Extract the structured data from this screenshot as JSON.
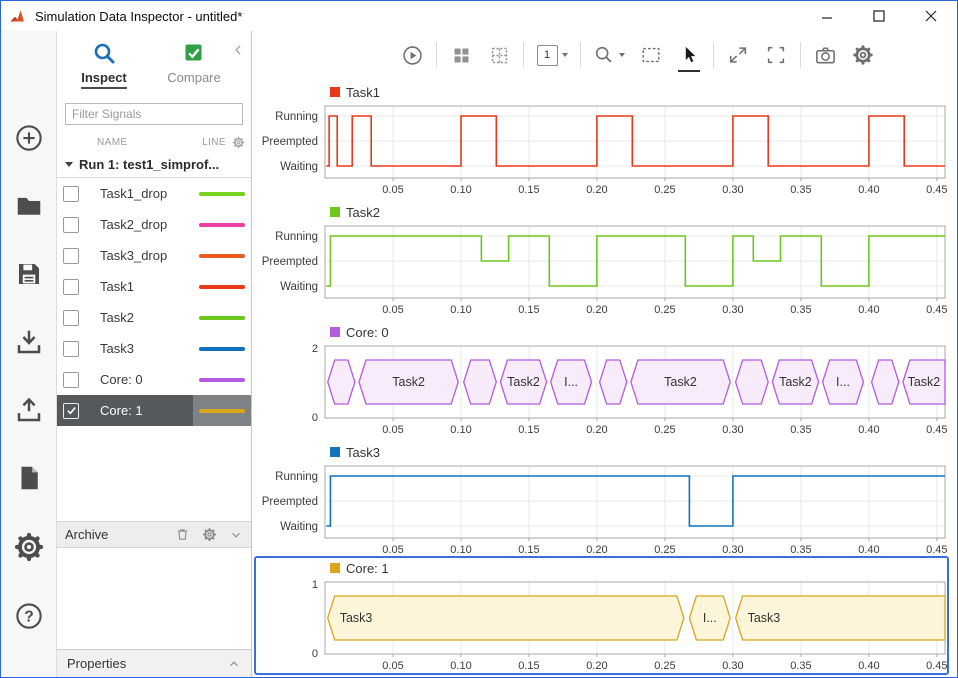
{
  "window": {
    "title": "Simulation Data Inspector - untitled*"
  },
  "rail": {
    "icons": [
      "add",
      "open",
      "save",
      "import",
      "export",
      "new-document",
      "settings",
      "help"
    ]
  },
  "panel": {
    "tabs": [
      {
        "label": "Inspect",
        "active": true
      },
      {
        "label": "Compare",
        "active": false
      }
    ],
    "filter": {
      "placeholder": "Filter Signals"
    },
    "columns": {
      "name": "NAME",
      "line": "LINE"
    },
    "run": {
      "label": "Run 1: test1_simprof..."
    },
    "signals": [
      {
        "name": "Task1_drop",
        "color": "#76d21e",
        "checked": false,
        "selected": false
      },
      {
        "name": "Task2_drop",
        "color": "#ea3fa4",
        "checked": false,
        "selected": false
      },
      {
        "name": "Task3_drop",
        "color": "#ea5a1e",
        "checked": false,
        "selected": false
      },
      {
        "name": "Task1",
        "color": "#e8391b",
        "checked": false,
        "selected": false
      },
      {
        "name": "Task2",
        "color": "#6ec71d",
        "checked": false,
        "selected": false
      },
      {
        "name": "Task3",
        "color": "#1272bd",
        "checked": false,
        "selected": false
      },
      {
        "name": "Core: 0",
        "color": "#b45be0",
        "checked": false,
        "selected": false
      },
      {
        "name": "Core: 1",
        "color": "#d9a61c",
        "checked": true,
        "selected": true
      }
    ],
    "archive": {
      "label": "Archive"
    },
    "properties": {
      "label": "Properties"
    }
  },
  "toolbar": {
    "layout_value": "1"
  },
  "axis": {
    "xmin": 0,
    "xmax": 0.456,
    "xticks": [
      0.05,
      0.1,
      0.15,
      0.2,
      0.25,
      0.3,
      0.35,
      0.4,
      0.45
    ]
  },
  "chart_data": [
    {
      "type": "step",
      "title": "Task1",
      "color": "#e8391b",
      "ylabels": [
        "Waiting",
        "Preempted",
        "Running"
      ],
      "steps": [
        [
          0.001,
          0
        ],
        [
          0.003,
          2
        ],
        [
          0.009,
          0
        ],
        [
          0.02,
          2
        ],
        [
          0.034,
          0
        ],
        [
          0.1,
          2
        ],
        [
          0.126,
          0
        ],
        [
          0.2,
          2
        ],
        [
          0.226,
          0
        ],
        [
          0.3,
          2
        ],
        [
          0.326,
          0
        ],
        [
          0.4,
          2
        ],
        [
          0.426,
          0
        ]
      ]
    },
    {
      "type": "step",
      "title": "Task2",
      "color": "#6ec71d",
      "ylabels": [
        "Waiting",
        "Preempted",
        "Running"
      ],
      "steps": [
        [
          0.001,
          0
        ],
        [
          0.004,
          2
        ],
        [
          0.115,
          1
        ],
        [
          0.135,
          2
        ],
        [
          0.165,
          0
        ],
        [
          0.2,
          2
        ],
        [
          0.265,
          0
        ],
        [
          0.3,
          2
        ],
        [
          0.315,
          1
        ],
        [
          0.335,
          2
        ],
        [
          0.365,
          0
        ],
        [
          0.4,
          2
        ]
      ]
    },
    {
      "type": "schedule",
      "title": "Core: 0",
      "color": "#b45be0",
      "fill": "#f7ebfc",
      "ymax": 2,
      "ymin": 0,
      "segments": [
        {
          "label": "",
          "start": 0.002,
          "end": 0.022
        },
        {
          "label": "Task2",
          "start": 0.025,
          "end": 0.098
        },
        {
          "label": "",
          "start": 0.102,
          "end": 0.126
        },
        {
          "label": "Task2",
          "start": 0.129,
          "end": 0.163
        },
        {
          "label": "I...",
          "start": 0.166,
          "end": 0.196
        },
        {
          "label": "",
          "start": 0.202,
          "end": 0.222
        },
        {
          "label": "Task2",
          "start": 0.225,
          "end": 0.298
        },
        {
          "label": "",
          "start": 0.302,
          "end": 0.326
        },
        {
          "label": "Task2",
          "start": 0.329,
          "end": 0.363
        },
        {
          "label": "I...",
          "start": 0.366,
          "end": 0.396
        },
        {
          "label": "",
          "start": 0.402,
          "end": 0.422
        },
        {
          "label": "Task2",
          "start": 0.425,
          "end": 0.462
        }
      ]
    },
    {
      "type": "step",
      "title": "Task3",
      "color": "#1272bd",
      "ylabels": [
        "Waiting",
        "Preempted",
        "Running"
      ],
      "steps": [
        [
          0.001,
          0
        ],
        [
          0.004,
          2
        ],
        [
          0.268,
          0
        ],
        [
          0.3,
          2
        ]
      ]
    },
    {
      "type": "schedule",
      "title": "Core: 1",
      "color": "#d9a61c",
      "fill": "#fdf5da",
      "ymax": 1,
      "ymin": 0,
      "selected": true,
      "segments": [
        {
          "label": "Task3",
          "start": 0.002,
          "end": 0.264
        },
        {
          "label": "I...",
          "start": 0.268,
          "end": 0.298
        },
        {
          "label": "Task3",
          "start": 0.302,
          "end": 0.462
        }
      ]
    }
  ]
}
